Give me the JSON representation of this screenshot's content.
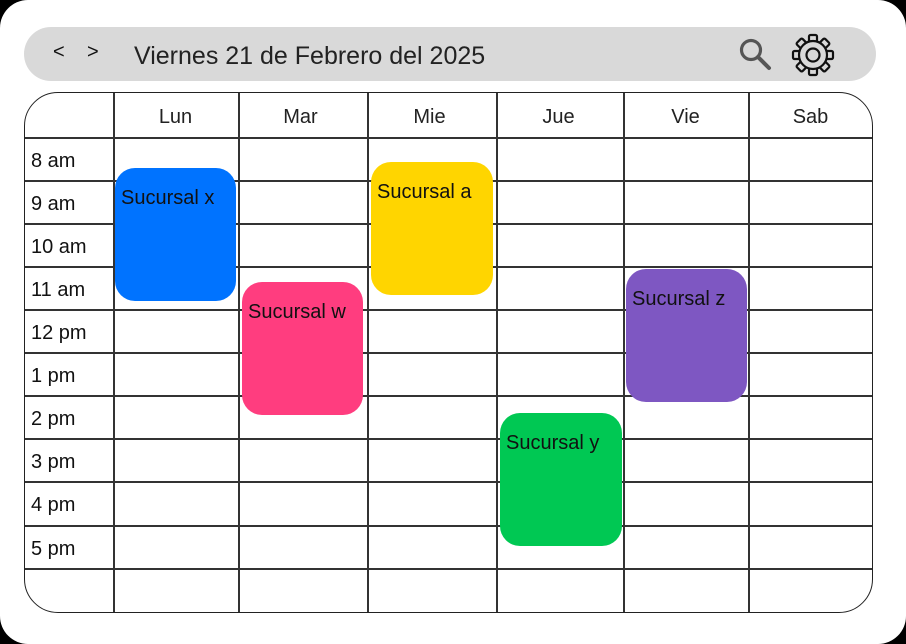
{
  "header": {
    "prev_label": "<",
    "next_label": ">",
    "date_title": "Viernes 21 de  Febrero del 2025",
    "search_icon": "search-icon",
    "settings_icon": "gear-icon"
  },
  "calendar": {
    "days": [
      "Lun",
      "Mar",
      "Mie",
      "Jue",
      "Vie",
      "Sab"
    ],
    "times": [
      "8 am",
      "9 am",
      "10 am",
      "11 am",
      "12 pm",
      "1 pm",
      "2 pm",
      "3 pm",
      "4 pm",
      "5 pm"
    ],
    "events": [
      {
        "label": "Sucursal x",
        "day": "Lun",
        "color": "#0073ff"
      },
      {
        "label": "Sucursal w",
        "day": "Mar",
        "color": "#ff3d7f"
      },
      {
        "label": "Sucursal a",
        "day": "Mie",
        "color": "#ffd500"
      },
      {
        "label": "Sucursal y",
        "day": "Jue",
        "color": "#00c853"
      },
      {
        "label": "Sucursal z",
        "day": "Vie",
        "color": "#7e57c2"
      }
    ]
  }
}
